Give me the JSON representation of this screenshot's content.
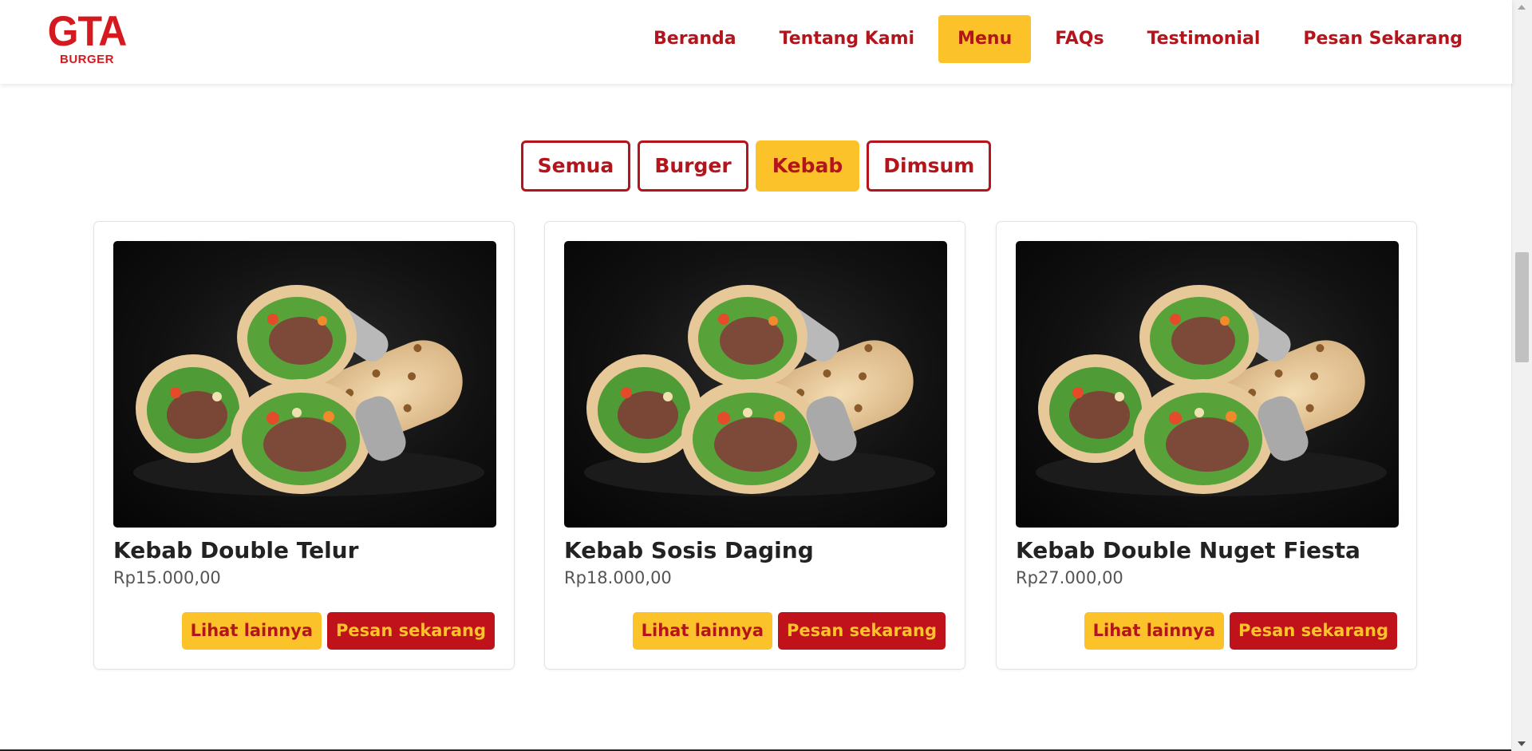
{
  "brand": {
    "logo_main": "GTA",
    "logo_sub": "BURGER"
  },
  "nav": {
    "items": [
      {
        "label": "Beranda",
        "active": false
      },
      {
        "label": "Tentang Kami",
        "active": false
      },
      {
        "label": "Menu",
        "active": true
      },
      {
        "label": "FAQs",
        "active": false
      },
      {
        "label": "Testimonial",
        "active": false
      },
      {
        "label": "Pesan Sekarang",
        "active": false
      }
    ]
  },
  "filters": {
    "items": [
      {
        "label": "Semua",
        "active": false
      },
      {
        "label": "Burger",
        "active": false
      },
      {
        "label": "Kebab",
        "active": true
      },
      {
        "label": "Dimsum",
        "active": false
      }
    ]
  },
  "products": [
    {
      "name": "Kebab Double Telur",
      "price": "Rp15.000,00",
      "more_label": "Lihat lainnya",
      "order_label": "Pesan sekarang"
    },
    {
      "name": "Kebab Sosis Daging",
      "price": "Rp18.000,00",
      "more_label": "Lihat lainnya",
      "order_label": "Pesan sekarang"
    },
    {
      "name": "Kebab Double Nuget Fiesta",
      "price": "Rp27.000,00",
      "more_label": "Lihat lainnya",
      "order_label": "Pesan sekarang"
    }
  ],
  "colors": {
    "brand_red": "#b4151c",
    "accent_yellow": "#fcc22a",
    "button_red": "#c0121b"
  }
}
